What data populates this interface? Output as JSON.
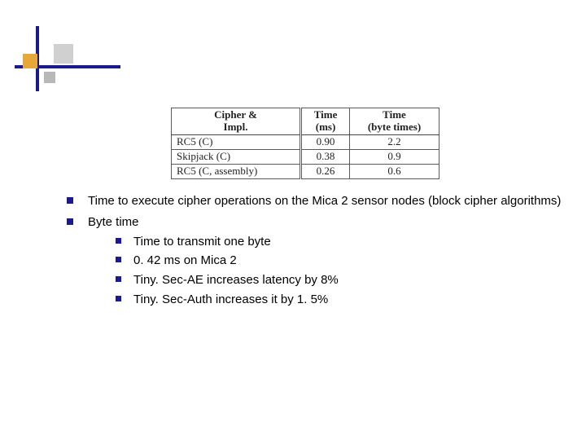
{
  "table": {
    "headers": {
      "col1_line1": "Cipher &",
      "col1_line2": "Impl.",
      "col2_line1": "Time",
      "col2_line2": "(ms)",
      "col3_line1": "Time",
      "col3_line2": "(byte times)"
    },
    "rows": [
      {
        "name": "RC5 (C)",
        "ms": "0.90",
        "bt": "2.2"
      },
      {
        "name": "Skipjack (C)",
        "ms": "0.38",
        "bt": "0.9"
      },
      {
        "name": "RC5 (C, assembly)",
        "ms": "0.26",
        "bt": "0.6"
      }
    ]
  },
  "bullets": {
    "b1": "Time to execute cipher operations on the Mica 2 sensor nodes (block cipher algorithms)",
    "b2": "Byte time",
    "b2_children": {
      "c1": "Time to transmit one byte",
      "c2": "0. 42 ms on Mica 2",
      "c3": "Tiny. Sec-AE increases latency by 8%",
      "c4": "Tiny. Sec-Auth increases it by 1. 5%"
    }
  },
  "chart_data": {
    "type": "table",
    "title": "Time to execute cipher operations on the Mica 2 sensor nodes (block cipher algorithms)",
    "columns": [
      "Cipher & Impl.",
      "Time (ms)",
      "Time (byte times)"
    ],
    "rows": [
      [
        "RC5 (C)",
        0.9,
        2.2
      ],
      [
        "Skipjack (C)",
        0.38,
        0.9
      ],
      [
        "RC5 (C, assembly)",
        0.26,
        0.6
      ]
    ]
  }
}
